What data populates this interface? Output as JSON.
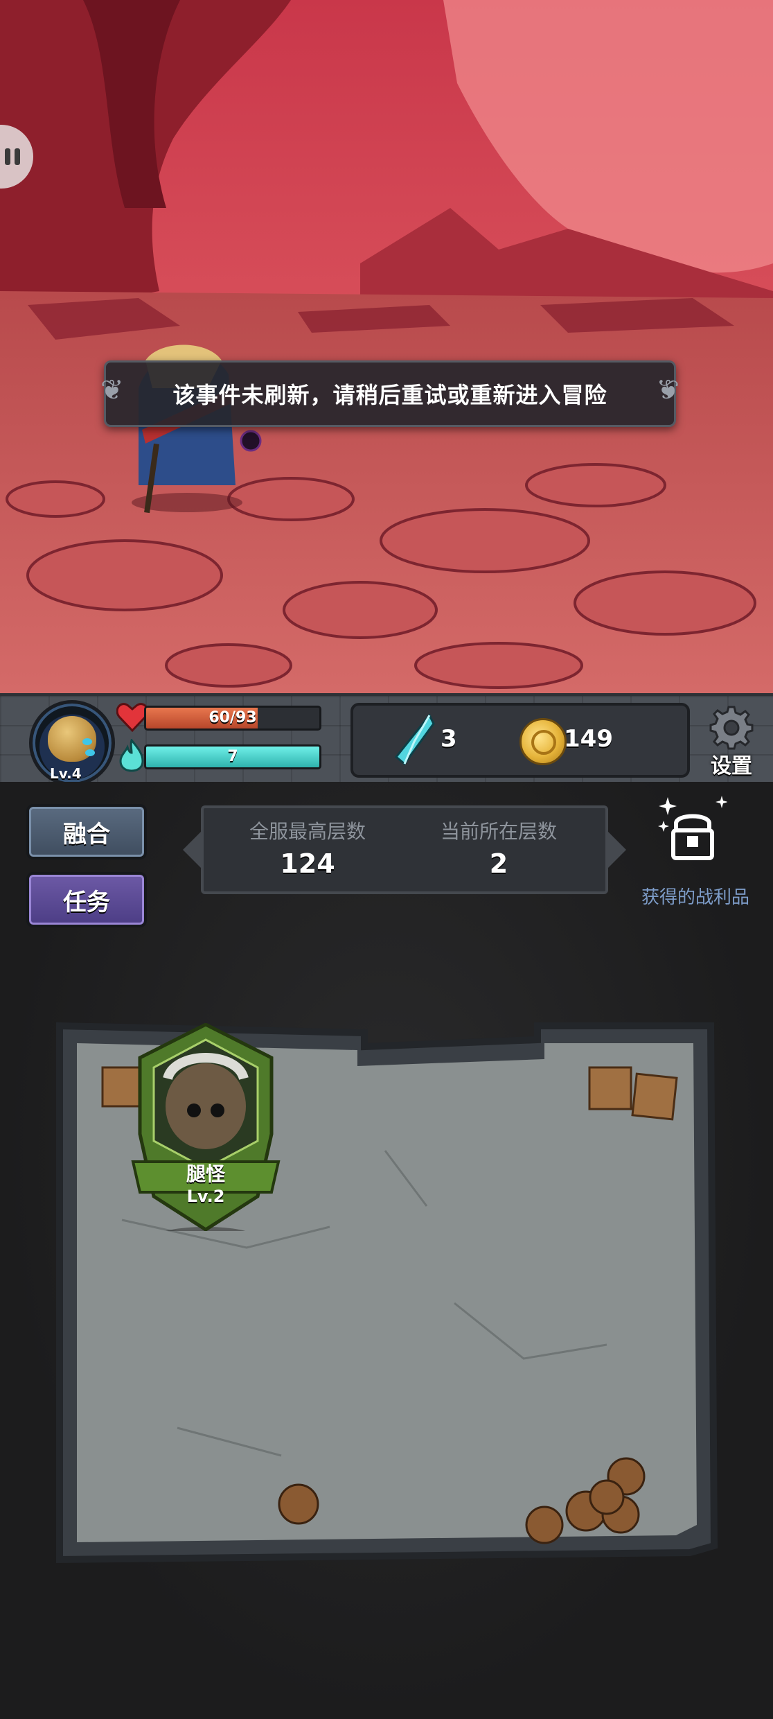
{
  "scene": {
    "toast_message": "该事件未刷新，请稍后重试或重新进入冒险"
  },
  "player": {
    "level": "Lv.4",
    "hp": "60/93",
    "hp_fraction": 0.645,
    "mana": "7",
    "mana_fraction": 1.0
  },
  "resources": {
    "crystals": "3",
    "coins": "149"
  },
  "settings": {
    "label": "设置"
  },
  "menu": {
    "fuse_label": "融合",
    "task_label": "任务"
  },
  "floors": {
    "server_best_label": "全服最高层数",
    "server_best_value": "124",
    "current_label": "当前所在层数",
    "current_value": "2"
  },
  "loot": {
    "label": "获得的战利品"
  },
  "enemy": {
    "name": "腿怪",
    "level": "Lv.2"
  },
  "colors": {
    "scene_sky": "#e05a62",
    "hp_fill": "#d65a38",
    "mana_fill": "#4fd3cc",
    "enemy_frame": "#4f7a2a",
    "loot_label": "#7d9cc8"
  }
}
